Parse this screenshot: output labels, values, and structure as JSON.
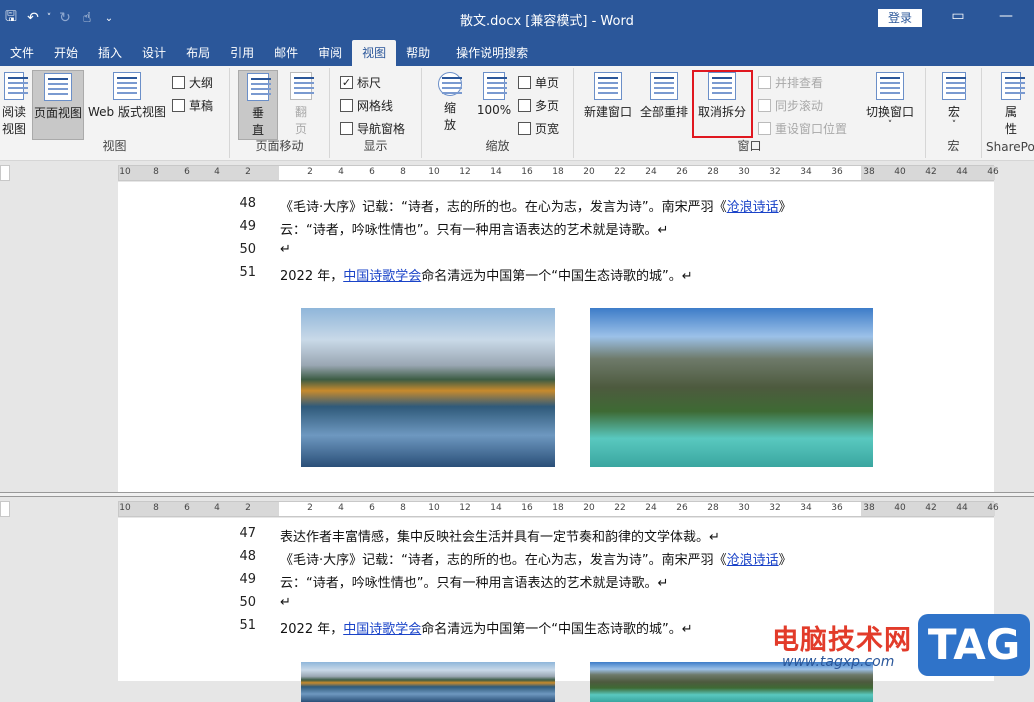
{
  "titlebar": {
    "title": "散文.docx [兼容模式] - Word",
    "login_label": "登录"
  },
  "tabs": [
    "文件",
    "开始",
    "插入",
    "设计",
    "布局",
    "引用",
    "邮件",
    "审阅",
    "视图",
    "帮助",
    "操作说明搜索"
  ],
  "active_tab": "视图",
  "ribbon": {
    "views": {
      "read_mode": "阅读\n视图",
      "print_layout": "页面视图",
      "web_layout": "Web 版式视图",
      "outline": "大纲",
      "draft": "草稿",
      "group_label": "视图"
    },
    "page_movement": {
      "vertical": "垂\n直",
      "side_by_side": "翻\n页",
      "group_label": "页面移动"
    },
    "show": {
      "ruler": "标尺",
      "ruler_checked": true,
      "gridlines": "网格线",
      "gridlines_checked": false,
      "nav_pane": "导航窗格",
      "nav_pane_checked": false,
      "group_label": "显示"
    },
    "zoom": {
      "zoom": "缩\n放",
      "hundred": "100%",
      "one_page": "单页",
      "multi_page": "多页",
      "page_width": "页宽",
      "group_label": "缩放"
    },
    "window": {
      "new_window": "新建窗口",
      "arrange_all": "全部重排",
      "remove_split": "取消拆分",
      "view_side_by_side": "并排查看",
      "sync_scroll": "同步滚动",
      "reset_position": "重设窗口位置",
      "switch_windows": "切换窗口",
      "group_label": "窗口"
    },
    "macros": {
      "macros": "宏",
      "group_label": "宏"
    },
    "sharepoint": {
      "properties": "属\n性",
      "group_label": "SharePo"
    }
  },
  "ruler_ticks": [
    "10",
    "8",
    "6",
    "4",
    "2",
    "2",
    "4",
    "6",
    "8",
    "10",
    "12",
    "14",
    "16",
    "18",
    "20",
    "22",
    "24",
    "26",
    "28",
    "30",
    "32",
    "34",
    "36",
    "38",
    "40",
    "42",
    "44",
    "46"
  ],
  "pane_top": {
    "lines": [
      {
        "num": "48",
        "text": "《毛诗·大序》记载：“诗者，志的所的也。在心为志，发言为诗”。南宋严羽《",
        "link": "沧浪诗话",
        "after": "》"
      },
      {
        "num": "49",
        "text": "云：“诗者，吟咏性情也”。只有一种用言语表达的艺术就是诗歌。↵",
        "link": "",
        "after": ""
      },
      {
        "num": "50",
        "text": "↵",
        "link": "",
        "after": ""
      },
      {
        "num": "51",
        "text": "2022 年，",
        "link": "中国诗歌学会",
        "after": "命名清远为中国第一个“中国生态诗歌的城”。↵"
      }
    ]
  },
  "pane_bottom": {
    "lines": [
      {
        "num": "47",
        "text": "表达作者丰富情感，集中反映社会生活并具有一定节奏和韵律的文学体裁。↵",
        "link": "",
        "after": ""
      },
      {
        "num": "48",
        "text": "《毛诗·大序》记载：“诗者，志的所的也。在心为志，发言为诗”。南宋严羽《",
        "link": "沧浪诗话",
        "after": "》"
      },
      {
        "num": "49",
        "text": "云：“诗者，吟咏性情也”。只有一种用言语表达的艺术就是诗歌。↵",
        "link": "",
        "after": ""
      },
      {
        "num": "50",
        "text": "↵",
        "link": "",
        "after": ""
      },
      {
        "num": "51",
        "text": "2022 年，",
        "link": "中国诗歌学会",
        "after": "命名清远为中国第一个“中国生态诗歌的城”。↵"
      }
    ]
  },
  "watermark": {
    "text": "电脑技术网",
    "url": "www.tagxp.com",
    "tag": "TAG"
  },
  "colors": {
    "brand": "#2b579a",
    "highlight_box": "#e0171f",
    "link": "#1a43c8"
  }
}
